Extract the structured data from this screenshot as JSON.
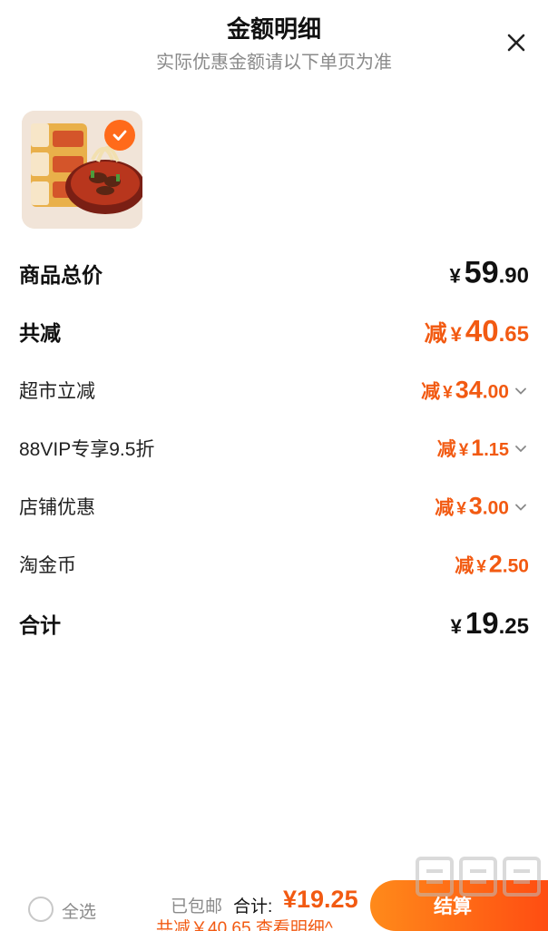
{
  "header": {
    "title": "金额明细",
    "subtitle": "实际优惠金额请以下单页为准"
  },
  "summary": {
    "subtotal": {
      "label": "商品总价",
      "currency": "¥",
      "int": "59",
      "dec": ".90"
    },
    "total_discount": {
      "label": "共减",
      "prefix": "减",
      "currency": "¥",
      "int": "40",
      "dec": ".65"
    },
    "discounts": [
      {
        "label": "超市立减",
        "prefix": "减",
        "currency": "¥",
        "int": "34",
        "dec": ".00",
        "expandable": true
      },
      {
        "label": "88VIP专享9.5折",
        "prefix": "减",
        "currency": "¥",
        "int": "1",
        "dec": ".15",
        "expandable": true
      },
      {
        "label": "店铺优惠",
        "prefix": "减",
        "currency": "¥",
        "int": "3",
        "dec": ".00",
        "expandable": true
      },
      {
        "label": "淘金币",
        "prefix": "减",
        "currency": "¥",
        "int": "2",
        "dec": ".50",
        "expandable": false
      }
    ],
    "total": {
      "label": "合计",
      "currency": "¥",
      "int": "19",
      "dec": ".25"
    }
  },
  "bottom_bar": {
    "select_all": "全选",
    "shipping": "已包邮",
    "total_label": "合计:",
    "total_value": "¥19.25",
    "saving": "共减￥40.65 查看明细^",
    "checkout": "结算"
  },
  "colors": {
    "accent": "#f25a12",
    "checkout_gradient_start": "#ff8a1a",
    "checkout_gradient_end": "#ff4d12"
  },
  "icons": [
    "close-icon",
    "check-icon",
    "chevron-down-icon"
  ]
}
